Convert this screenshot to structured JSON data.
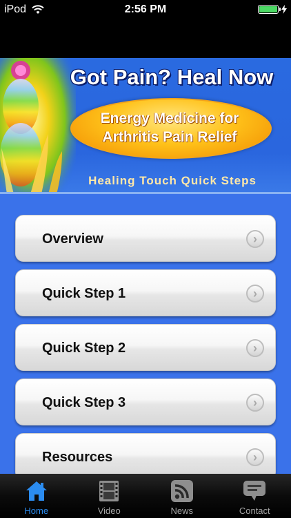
{
  "status_bar": {
    "carrier": "iPod",
    "time": "2:56 PM",
    "battery_level": 1.0,
    "battery_color": "#4cd964",
    "icons": [
      "wifi-icon",
      "battery-icon",
      "charging-bolt-icon"
    ]
  },
  "banner": {
    "title": "Got Pain? Heal Now",
    "oval_line1": "Energy Medicine for",
    "oval_line2": "Arthritis Pain Relief",
    "subtitle": "Healing Touch Quick Steps"
  },
  "menu": {
    "items": [
      {
        "label": "Overview"
      },
      {
        "label": "Quick Step 1"
      },
      {
        "label": "Quick Step 2"
      },
      {
        "label": "Quick Step 3"
      },
      {
        "label": "Resources"
      }
    ],
    "chevron_glyph": "›"
  },
  "tab_bar": {
    "tabs": [
      {
        "label": "Home",
        "icon": "home-icon",
        "active": true
      },
      {
        "label": "Video",
        "icon": "film-icon",
        "active": false
      },
      {
        "label": "News",
        "icon": "rss-icon",
        "active": false
      },
      {
        "label": "Contact",
        "icon": "speech-bubble-icon",
        "active": false
      }
    ],
    "active_color": "#2b8cf0"
  },
  "colors": {
    "menu_background": "#3a72ea",
    "banner_background": "#2a6ae0"
  }
}
